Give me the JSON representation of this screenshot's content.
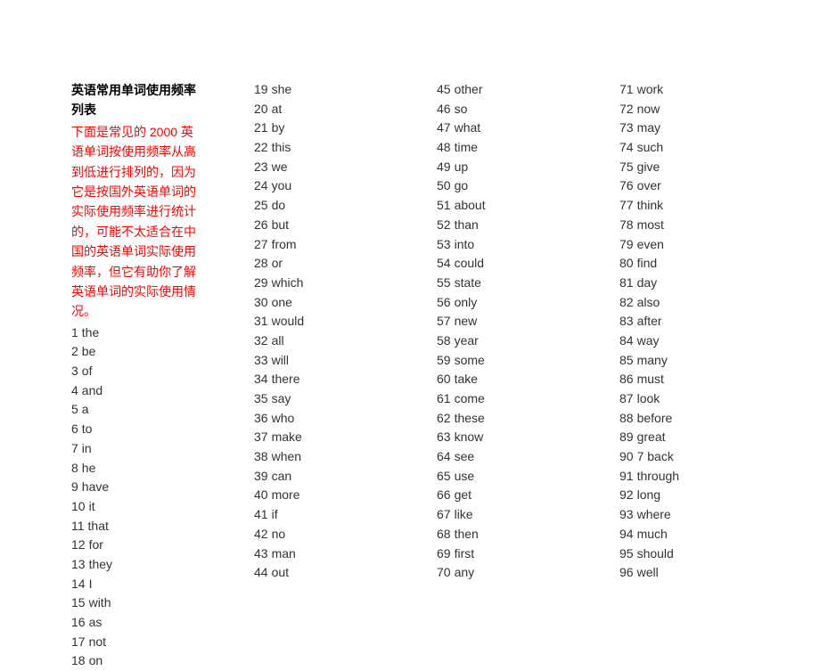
{
  "title": "英语常用单词使用频率列表",
  "intro": "下面是常见的 2000 英语单词按使用频率从高到低进行排列的，因为它是按国外英语单词的实际使用频率进行统计的，可能不太适合在中国的英语单词实际使用频率，但它有助你了解英语单词的实际使用情况。",
  "words": [
    {
      "n": "1",
      "w": "the"
    },
    {
      "n": "2",
      "w": "be"
    },
    {
      "n": "3",
      "w": "of"
    },
    {
      "n": "4",
      "w": "and"
    },
    {
      "n": "5",
      "w": "a"
    },
    {
      "n": "6",
      "w": "to"
    },
    {
      "n": "7",
      "w": "in"
    },
    {
      "n": "8",
      "w": "he"
    },
    {
      "n": "9",
      "w": "have"
    },
    {
      "n": "10",
      "w": "it"
    },
    {
      "n": "11",
      "w": "that"
    },
    {
      "n": "12",
      "w": "for"
    },
    {
      "n": "13",
      "w": "they"
    },
    {
      "n": "14",
      "w": "I"
    },
    {
      "n": "15",
      "w": "with"
    },
    {
      "n": "16",
      "w": "as"
    },
    {
      "n": "17",
      "w": "not"
    },
    {
      "n": "18",
      "w": "on"
    },
    {
      "n": "19",
      "w": "she"
    },
    {
      "n": "20",
      "w": "at"
    },
    {
      "n": "21",
      "w": "by"
    },
    {
      "n": "22",
      "w": "this"
    },
    {
      "n": "23",
      "w": "we"
    },
    {
      "n": "24",
      "w": "you"
    },
    {
      "n": "25",
      "w": "do"
    },
    {
      "n": "26",
      "w": "but"
    },
    {
      "n": "27",
      "w": "from"
    },
    {
      "n": "28",
      "w": "or"
    },
    {
      "n": "29",
      "w": "which"
    },
    {
      "n": "30",
      "w": "one"
    },
    {
      "n": "31",
      "w": "would"
    },
    {
      "n": "32",
      "w": "all"
    },
    {
      "n": "33",
      "w": "will"
    },
    {
      "n": "34",
      "w": "there"
    },
    {
      "n": "35",
      "w": "say"
    },
    {
      "n": "36",
      "w": "who"
    },
    {
      "n": "37",
      "w": "make"
    },
    {
      "n": "38",
      "w": "when"
    },
    {
      "n": "39",
      "w": "can"
    },
    {
      "n": "40",
      "w": "more"
    },
    {
      "n": "41",
      "w": "if"
    },
    {
      "n": "42",
      "w": "no"
    },
    {
      "n": "43",
      "w": "man"
    },
    {
      "n": "44",
      "w": "out"
    },
    {
      "n": "45",
      "w": "other"
    },
    {
      "n": "46",
      "w": "so"
    },
    {
      "n": "47",
      "w": "what"
    },
    {
      "n": "48",
      "w": "time"
    },
    {
      "n": "49",
      "w": "up"
    },
    {
      "n": "50",
      "w": "go"
    },
    {
      "n": "51",
      "w": "about"
    },
    {
      "n": "52",
      "w": "than"
    },
    {
      "n": "53",
      "w": "into"
    },
    {
      "n": "54",
      "w": "could"
    },
    {
      "n": "55",
      "w": "state"
    },
    {
      "n": "56",
      "w": "only"
    },
    {
      "n": "57",
      "w": "new"
    },
    {
      "n": "58",
      "w": "year"
    },
    {
      "n": "59",
      "w": "some"
    },
    {
      "n": "60",
      "w": "take"
    },
    {
      "n": "61",
      "w": "come"
    },
    {
      "n": "62",
      "w": "these"
    },
    {
      "n": "63",
      "w": "know"
    },
    {
      "n": "64",
      "w": "see"
    },
    {
      "n": "65",
      "w": "use"
    },
    {
      "n": "66",
      "w": "get"
    },
    {
      "n": "67",
      "w": "like"
    },
    {
      "n": "68",
      "w": "then"
    },
    {
      "n": "69",
      "w": "first"
    },
    {
      "n": "70",
      "w": "any"
    },
    {
      "n": "71",
      "w": "work"
    },
    {
      "n": "72",
      "w": "now"
    },
    {
      "n": "73",
      "w": "may"
    },
    {
      "n": "74",
      "w": "such"
    },
    {
      "n": "75",
      "w": "give"
    },
    {
      "n": "76",
      "w": "over"
    },
    {
      "n": "77",
      "w": "think"
    },
    {
      "n": "78",
      "w": "most"
    },
    {
      "n": "79",
      "w": "even"
    },
    {
      "n": "80",
      "w": "find"
    },
    {
      "n": "81",
      "w": "day"
    },
    {
      "n": "82",
      "w": "also"
    },
    {
      "n": "83",
      "w": "after"
    },
    {
      "n": "84",
      "w": "way"
    },
    {
      "n": "85",
      "w": "many"
    },
    {
      "n": "86",
      "w": "must"
    },
    {
      "n": "87",
      "w": "look"
    },
    {
      "n": "88",
      "w": "before"
    },
    {
      "n": "89",
      "w": "great"
    },
    {
      "n": "90",
      "w": "7 back"
    },
    {
      "n": "91",
      "w": "through"
    },
    {
      "n": "92",
      "w": "long"
    },
    {
      "n": "93",
      "w": "where"
    },
    {
      "n": "94",
      "w": "much"
    },
    {
      "n": "95",
      "w": "should"
    },
    {
      "n": "96",
      "w": "well"
    }
  ],
  "column_ranges": [
    {
      "start": 0,
      "end": 18,
      "has_header": true
    },
    {
      "start": 18,
      "end": 44,
      "has_header": false
    },
    {
      "start": 44,
      "end": 70,
      "has_header": false
    },
    {
      "start": 70,
      "end": 96,
      "has_header": false
    }
  ]
}
